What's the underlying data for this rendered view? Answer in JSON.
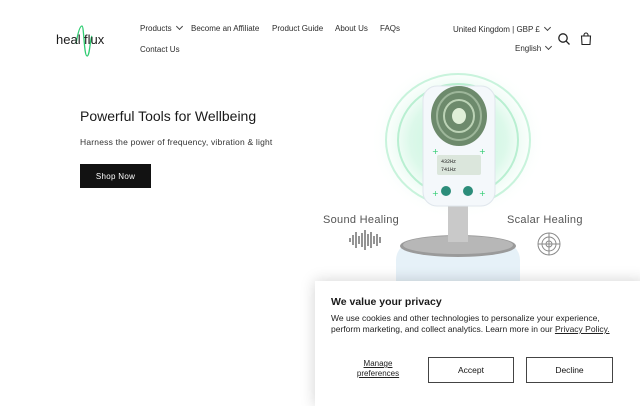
{
  "brand": {
    "logo_part1": "heal",
    "logo_part2": "flux"
  },
  "nav": {
    "items": [
      {
        "label": "Products"
      },
      {
        "label": "Become an Affiliate"
      },
      {
        "label": "Product Guide"
      },
      {
        "label": "About Us"
      },
      {
        "label": "FAQs"
      },
      {
        "label": "Contact Us"
      }
    ],
    "country": "United Kingdom | GBP £",
    "language": "English"
  },
  "hero": {
    "title": "Powerful Tools for Wellbeing",
    "subtitle": "Harness the power of frequency, vibration & light",
    "cta_label": "Shop Now",
    "label_left": "Sound Healing",
    "label_right": "Scalar Healing",
    "device_screen": [
      "432Hz",
      "741Hz"
    ]
  },
  "cookie": {
    "title": "We value your privacy",
    "body": "We use cookies and other technologies to personalize your experience, perform marketing, and collect analytics. Learn more in our ",
    "link": "Privacy Policy.",
    "manage_label": "Manage preferences",
    "accept_label": "Accept",
    "decline_label": "Decline"
  },
  "colors": {
    "accent": "#2ecc71",
    "button_dark": "#121212",
    "glow": "#c8f5de"
  }
}
